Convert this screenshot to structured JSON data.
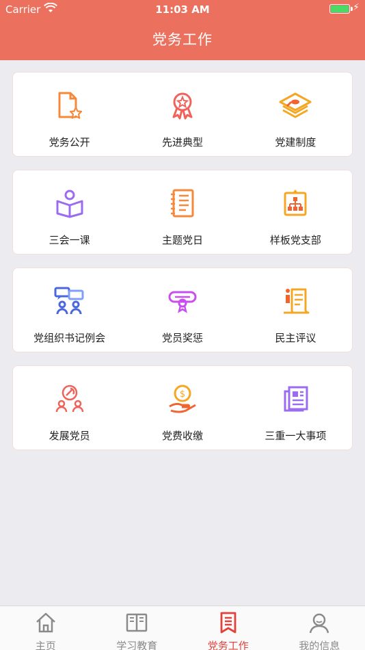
{
  "status_bar": {
    "carrier": "Carrier",
    "time": "11:03 AM"
  },
  "nav": {
    "title": "党务工作"
  },
  "colors": {
    "header": "#ec705e",
    "active_tab": "#e4403a",
    "inactive_tab": "#8a8a8a",
    "battery": "#4cd964"
  },
  "grid": {
    "rows": [
      {
        "items": [
          {
            "label": "党务公开",
            "icon": "document-star-icon"
          },
          {
            "label": "先进典型",
            "icon": "award-badge-icon"
          },
          {
            "label": "党建制度",
            "icon": "layers-stack-icon"
          }
        ]
      },
      {
        "items": [
          {
            "label": "三会一课",
            "icon": "person-book-icon"
          },
          {
            "label": "主题党日",
            "icon": "notebook-icon"
          },
          {
            "label": "样板党支部",
            "icon": "org-board-icon"
          }
        ]
      },
      {
        "items": [
          {
            "label": "党组织书记例会",
            "icon": "meeting-chat-icon"
          },
          {
            "label": "党员奖惩",
            "icon": "diploma-scroll-icon"
          },
          {
            "label": "民主评议",
            "icon": "scroll-person-icon"
          }
        ]
      },
      {
        "items": [
          {
            "label": "发展党员",
            "icon": "party-members-icon"
          },
          {
            "label": "党费收缴",
            "icon": "coin-hand-icon"
          },
          {
            "label": "三重一大事项",
            "icon": "newspaper-icon"
          }
        ]
      }
    ]
  },
  "tabbar": {
    "tabs": [
      {
        "label": "主页",
        "icon": "home-icon"
      },
      {
        "label": "学习教育",
        "icon": "open-book-icon"
      },
      {
        "label": "党务工作",
        "icon": "bookmark-list-icon",
        "active": true
      },
      {
        "label": "我的信息",
        "icon": "user-icon"
      }
    ]
  }
}
